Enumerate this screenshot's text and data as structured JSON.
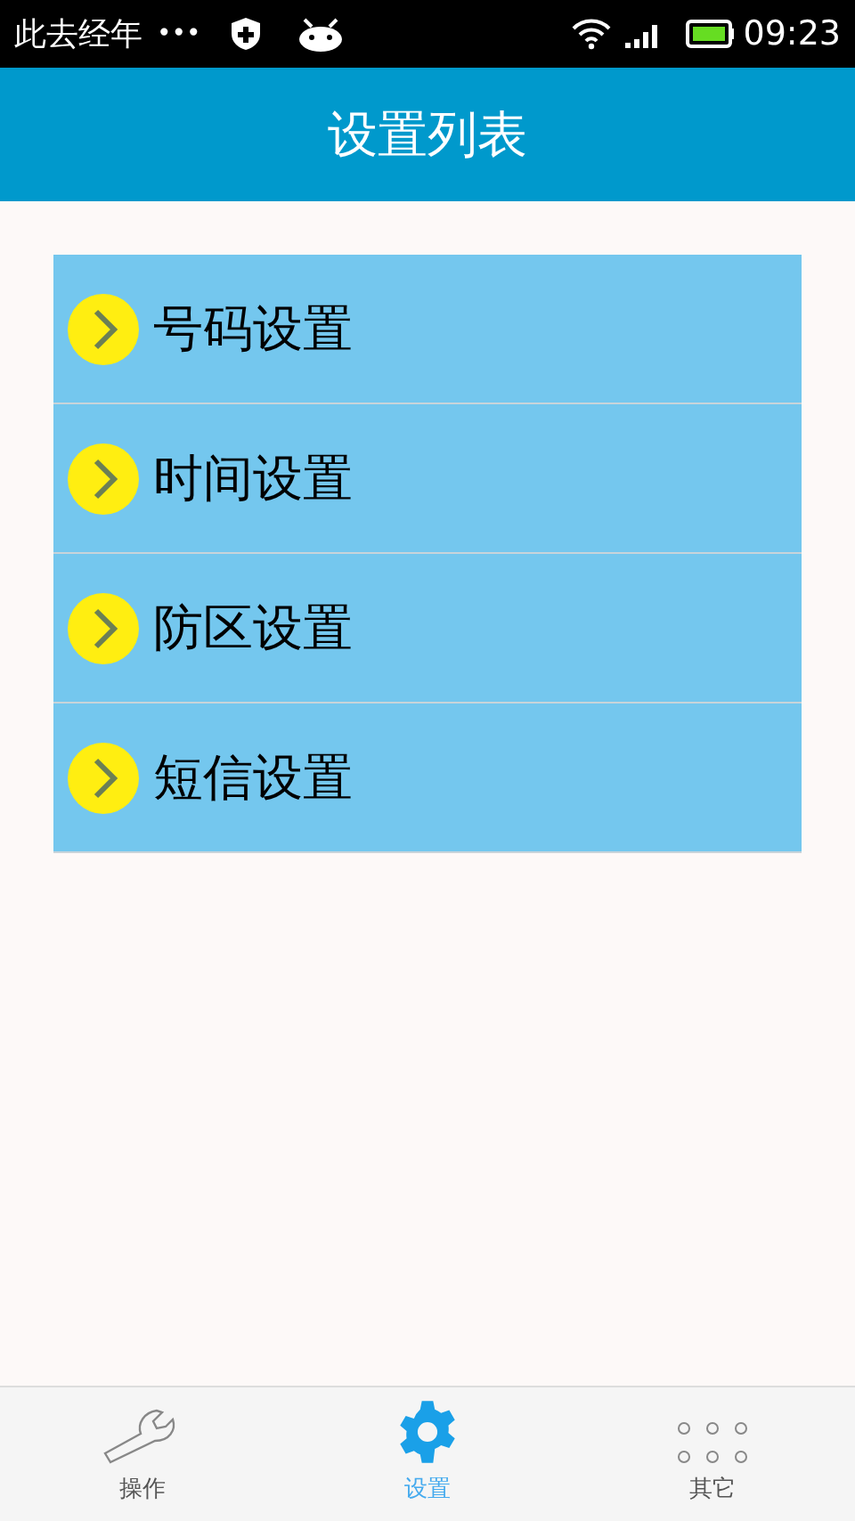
{
  "status_bar": {
    "carrier": "此去经年",
    "dots": "•••",
    "time": "09:23"
  },
  "header": {
    "title": "设置列表"
  },
  "menu": [
    {
      "label": "号码设置"
    },
    {
      "label": "时间设置"
    },
    {
      "label": "防区设置"
    },
    {
      "label": "短信设置"
    }
  ],
  "tabs": [
    {
      "label": "操作",
      "kind": "wrench",
      "selected": false
    },
    {
      "label": "设置",
      "kind": "gear",
      "selected": true
    },
    {
      "label": "其它",
      "kind": "dots",
      "selected": false
    }
  ]
}
